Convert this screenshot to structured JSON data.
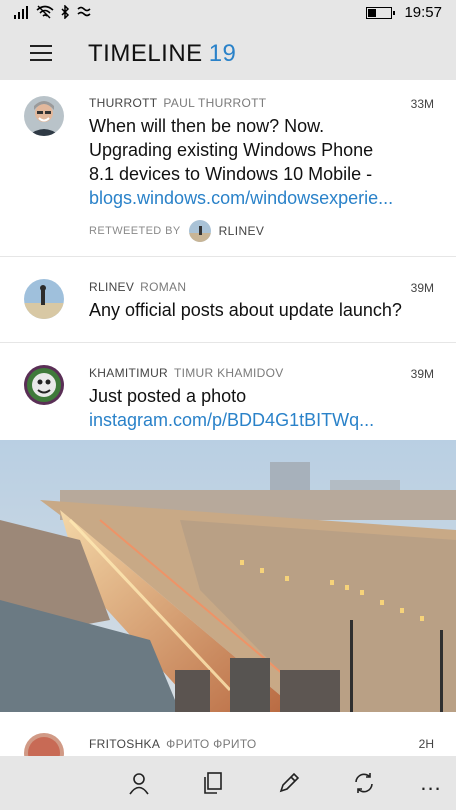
{
  "status_bar": {
    "time": "19:57",
    "icons": [
      "signal-icon",
      "wifi-icon",
      "bluetooth-icon",
      "location-icon",
      "battery-icon"
    ]
  },
  "app_bar": {
    "title": "TIMELINE",
    "count": "19"
  },
  "tweets": [
    {
      "handle": "THURROTT",
      "fullname": "PAUL THURROTT",
      "time": "33M",
      "text": "When will then be now? Now. Upgrading existing Windows Phone 8.1 devices to Windows 10 Mobile -",
      "link": "blogs.windows.com/windowsexperie...",
      "retweeted_by_label": "RETWEETED BY",
      "retweeted_by": "RLINEV"
    },
    {
      "handle": "RLINEV",
      "fullname": "ROMAN",
      "time": "39M",
      "text": "Any official posts about update launch?"
    },
    {
      "handle": "KHAMITIMUR",
      "fullname": "TIMUR KHAMIDOV",
      "time": "39M",
      "text": "Just posted a photo",
      "link": "instagram.com/p/BDD4G1tBITWq..."
    },
    {
      "handle": "FRITOSHKA",
      "fullname": "ФРИТО ФРИТО",
      "time": "2H"
    }
  ],
  "bottom_bar": {
    "buttons": [
      "profile-icon",
      "drafts-icon",
      "compose-icon",
      "refresh-icon",
      "more-icon"
    ],
    "more_label": "..."
  },
  "colors": {
    "accent": "#2a82c9",
    "bar_background": "#e6e6e6"
  }
}
